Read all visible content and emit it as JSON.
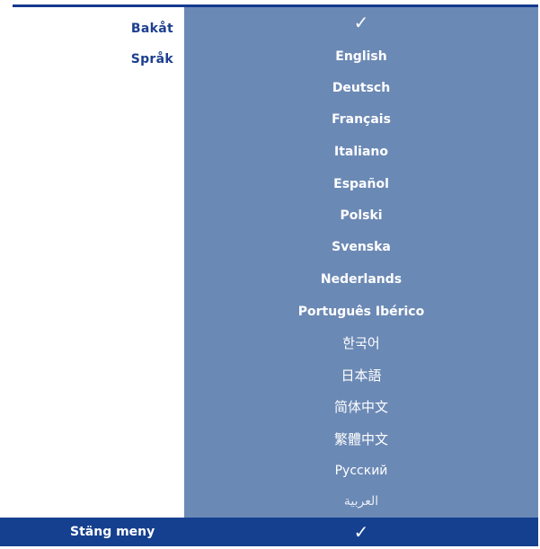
{
  "menu": {
    "back_label": "Bakåt",
    "language_label": "Språk",
    "back_check": "✓",
    "options": [
      "English",
      "Deutsch",
      "Français",
      "Italiano",
      "Español",
      "Polski",
      "Svenska",
      "Nederlands",
      "Português Ibérico",
      "한국어",
      "日本語",
      "简体中文",
      "繁體中文",
      "Русский",
      "العربية"
    ]
  },
  "footer": {
    "close_label": "Stäng meny",
    "close_check": "✓"
  },
  "colors": {
    "panel": "#6b89b5",
    "bar": "#15408f",
    "label": "#1d3f8f"
  }
}
